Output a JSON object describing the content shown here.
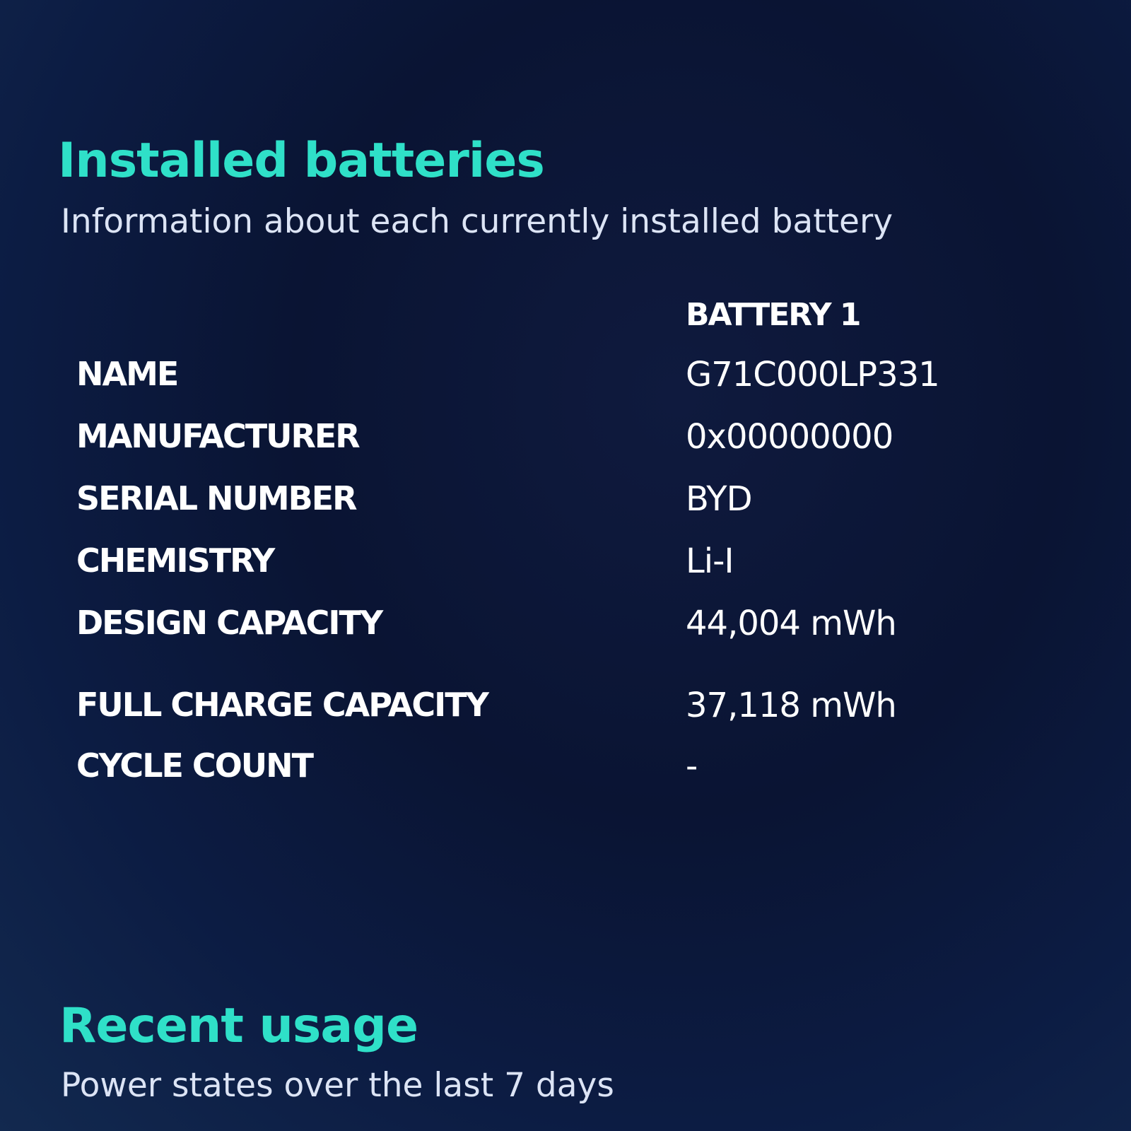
{
  "installed_batteries": {
    "title": "Installed batteries",
    "subtitle": "Information about each currently installed battery",
    "column_header": "BATTERY 1",
    "rows": [
      {
        "label": "NAME",
        "value": "G71C000LP331"
      },
      {
        "label": "MANUFACTURER",
        "value": "0x00000000"
      },
      {
        "label": "SERIAL NUMBER",
        "value": "BYD"
      },
      {
        "label": "CHEMISTRY",
        "value": "Li-I"
      },
      {
        "label": "DESIGN CAPACITY",
        "value": "44,004 mWh"
      },
      {
        "label": "FULL CHARGE CAPACITY",
        "value": "37,118 mWh"
      },
      {
        "label": "CYCLE COUNT",
        "value": "-"
      }
    ]
  },
  "recent_usage": {
    "title": "Recent usage",
    "subtitle": "Power states over the last 7 days"
  },
  "colors": {
    "background": "#0a1433",
    "heading": "#2fe0c8",
    "text": "#ffffff"
  }
}
